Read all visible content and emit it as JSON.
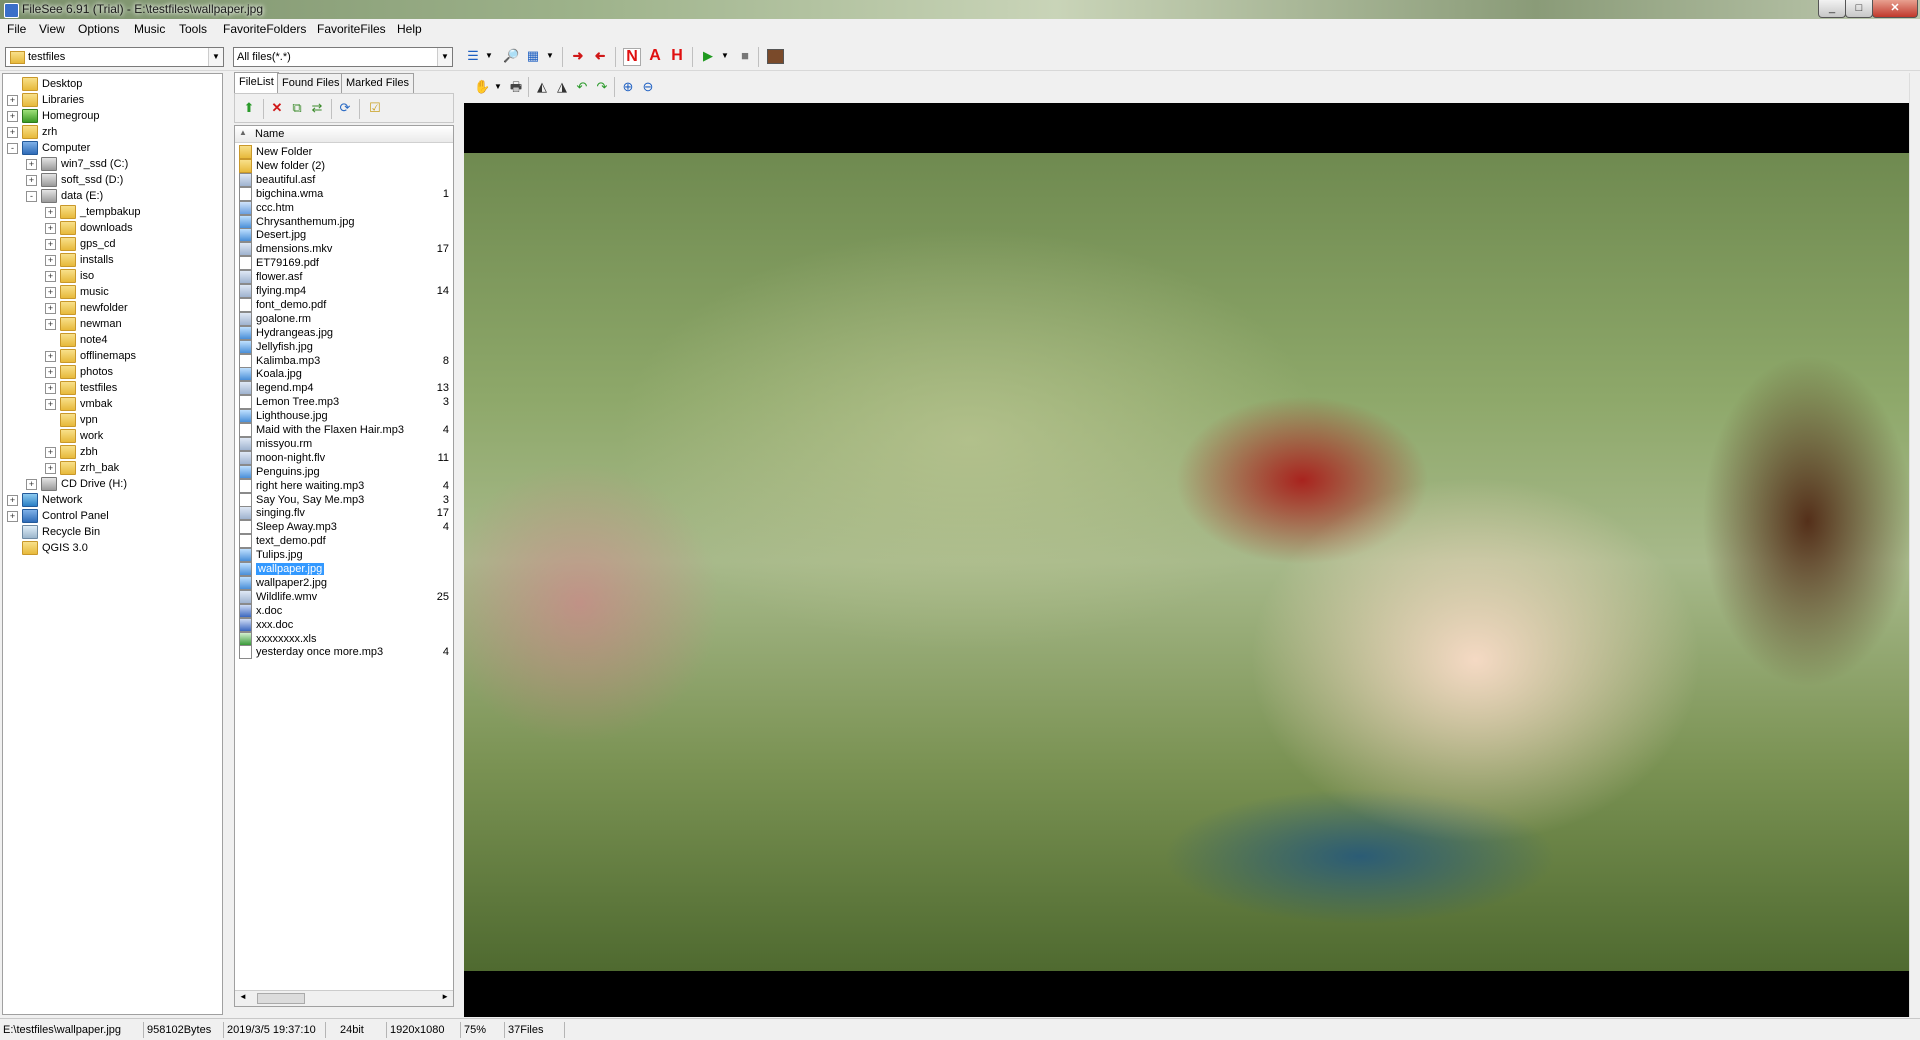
{
  "window": {
    "title": "FileSee 6.91 (Trial) - E:\\testfiles\\wallpaper.jpg"
  },
  "menu": [
    "File",
    "View",
    "Options",
    "Music",
    "Tools",
    "FavoriteFolders",
    "FavoriteFiles",
    "Help"
  ],
  "toolbar": {
    "folder_combo": "testfiles",
    "filter_combo": "All files(*.*)",
    "letters": [
      "N",
      "A",
      "H"
    ]
  },
  "tree": [
    {
      "label": "Desktop",
      "level": 0,
      "icon": "folder",
      "exp": ""
    },
    {
      "label": "Libraries",
      "level": 0,
      "icon": "folder",
      "exp": "+"
    },
    {
      "label": "Homegroup",
      "level": 0,
      "icon": "green",
      "exp": "+"
    },
    {
      "label": "zrh",
      "level": 0,
      "icon": "folder",
      "exp": "+"
    },
    {
      "label": "Computer",
      "level": 0,
      "icon": "comp",
      "exp": "-"
    },
    {
      "label": "win7_ssd (C:)",
      "level": 1,
      "icon": "drive",
      "exp": "+"
    },
    {
      "label": "soft_ssd (D:)",
      "level": 1,
      "icon": "drive",
      "exp": "+"
    },
    {
      "label": "data (E:)",
      "level": 1,
      "icon": "drive",
      "exp": "-"
    },
    {
      "label": "_tempbakup",
      "level": 2,
      "icon": "folder",
      "exp": "+"
    },
    {
      "label": "downloads",
      "level": 2,
      "icon": "folder",
      "exp": "+"
    },
    {
      "label": "gps_cd",
      "level": 2,
      "icon": "folder",
      "exp": "+"
    },
    {
      "label": "installs",
      "level": 2,
      "icon": "folder",
      "exp": "+"
    },
    {
      "label": "iso",
      "level": 2,
      "icon": "folder",
      "exp": "+"
    },
    {
      "label": "music",
      "level": 2,
      "icon": "folder",
      "exp": "+"
    },
    {
      "label": "newfolder",
      "level": 2,
      "icon": "folder",
      "exp": "+"
    },
    {
      "label": "newman",
      "level": 2,
      "icon": "folder",
      "exp": "+"
    },
    {
      "label": "note4",
      "level": 2,
      "icon": "folder",
      "exp": ""
    },
    {
      "label": "offlinemaps",
      "level": 2,
      "icon": "folder",
      "exp": "+"
    },
    {
      "label": "photos",
      "level": 2,
      "icon": "folder",
      "exp": "+"
    },
    {
      "label": "testfiles",
      "level": 2,
      "icon": "folder",
      "exp": "+"
    },
    {
      "label": "vmbak",
      "level": 2,
      "icon": "folder",
      "exp": "+"
    },
    {
      "label": "vpn",
      "level": 2,
      "icon": "folder",
      "exp": ""
    },
    {
      "label": "work",
      "level": 2,
      "icon": "folder",
      "exp": ""
    },
    {
      "label": "zbh",
      "level": 2,
      "icon": "folder",
      "exp": "+"
    },
    {
      "label": "zrh_bak",
      "level": 2,
      "icon": "folder",
      "exp": "+"
    },
    {
      "label": "CD Drive (H:)",
      "level": 1,
      "icon": "drive",
      "exp": "+"
    },
    {
      "label": "Network",
      "level": 0,
      "icon": "net",
      "exp": "+"
    },
    {
      "label": "Control Panel",
      "level": 0,
      "icon": "comp",
      "exp": "+"
    },
    {
      "label": "Recycle Bin",
      "level": 0,
      "icon": "bin",
      "exp": ""
    },
    {
      "label": "QGIS 3.0",
      "level": 0,
      "icon": "folder",
      "exp": ""
    }
  ],
  "tabs": [
    "FileList",
    "Found Files",
    "Marked Files"
  ],
  "filelist": {
    "column_header": "Name",
    "files": [
      {
        "name": "New Folder",
        "size": "",
        "type": "folder"
      },
      {
        "name": "New folder (2)",
        "size": "",
        "type": "folder"
      },
      {
        "name": "beautiful.asf",
        "size": "",
        "type": "video"
      },
      {
        "name": "bigchina.wma",
        "size": "1",
        "type": "audio"
      },
      {
        "name": "ccc.htm",
        "size": "",
        "type": "web"
      },
      {
        "name": "Chrysanthemum.jpg",
        "size": "",
        "type": "image"
      },
      {
        "name": "Desert.jpg",
        "size": "",
        "type": "image"
      },
      {
        "name": "dmensions.mkv",
        "size": "17",
        "type": "video"
      },
      {
        "name": "ET79169.pdf",
        "size": "",
        "type": "doc"
      },
      {
        "name": "flower.asf",
        "size": "",
        "type": "video"
      },
      {
        "name": "flying.mp4",
        "size": "14",
        "type": "video"
      },
      {
        "name": "font_demo.pdf",
        "size": "",
        "type": "doc"
      },
      {
        "name": "goalone.rm",
        "size": "",
        "type": "video"
      },
      {
        "name": "Hydrangeas.jpg",
        "size": "",
        "type": "image"
      },
      {
        "name": "Jellyfish.jpg",
        "size": "",
        "type": "image"
      },
      {
        "name": "Kalimba.mp3",
        "size": "8",
        "type": "audio"
      },
      {
        "name": "Koala.jpg",
        "size": "",
        "type": "image"
      },
      {
        "name": "legend.mp4",
        "size": "13",
        "type": "video"
      },
      {
        "name": "Lemon Tree.mp3",
        "size": "3",
        "type": "audio"
      },
      {
        "name": "Lighthouse.jpg",
        "size": "",
        "type": "image"
      },
      {
        "name": "Maid with the Flaxen Hair.mp3",
        "size": "4",
        "type": "audio"
      },
      {
        "name": "missyou.rm",
        "size": "",
        "type": "video"
      },
      {
        "name": "moon-night.flv",
        "size": "11",
        "type": "video"
      },
      {
        "name": "Penguins.jpg",
        "size": "",
        "type": "image"
      },
      {
        "name": "right here waiting.mp3",
        "size": "4",
        "type": "audio"
      },
      {
        "name": "Say You, Say Me.mp3",
        "size": "3",
        "type": "audio"
      },
      {
        "name": "singing.flv",
        "size": "17",
        "type": "video"
      },
      {
        "name": "Sleep Away.mp3",
        "size": "4",
        "type": "audio"
      },
      {
        "name": "text_demo.pdf",
        "size": "",
        "type": "doc"
      },
      {
        "name": "Tulips.jpg",
        "size": "",
        "type": "image"
      },
      {
        "name": "wallpaper.jpg",
        "size": "",
        "type": "image",
        "selected": true
      },
      {
        "name": "wallpaper2.jpg",
        "size": "",
        "type": "image"
      },
      {
        "name": "Wildlife.wmv",
        "size": "25",
        "type": "video"
      },
      {
        "name": "x.doc",
        "size": "",
        "type": "word"
      },
      {
        "name": "xxx.doc",
        "size": "",
        "type": "word"
      },
      {
        "name": "xxxxxxxx.xls",
        "size": "",
        "type": "excel"
      },
      {
        "name": "yesterday once more.mp3",
        "size": "4",
        "type": "audio"
      }
    ]
  },
  "statusbar": {
    "path": "E:\\testfiles\\wallpaper.jpg",
    "size": "958102Bytes",
    "date": "2019/3/5 19:37:10",
    "depth": "24bit",
    "dimensions": "1920x1080",
    "zoom": "75%",
    "count": "37Files"
  }
}
